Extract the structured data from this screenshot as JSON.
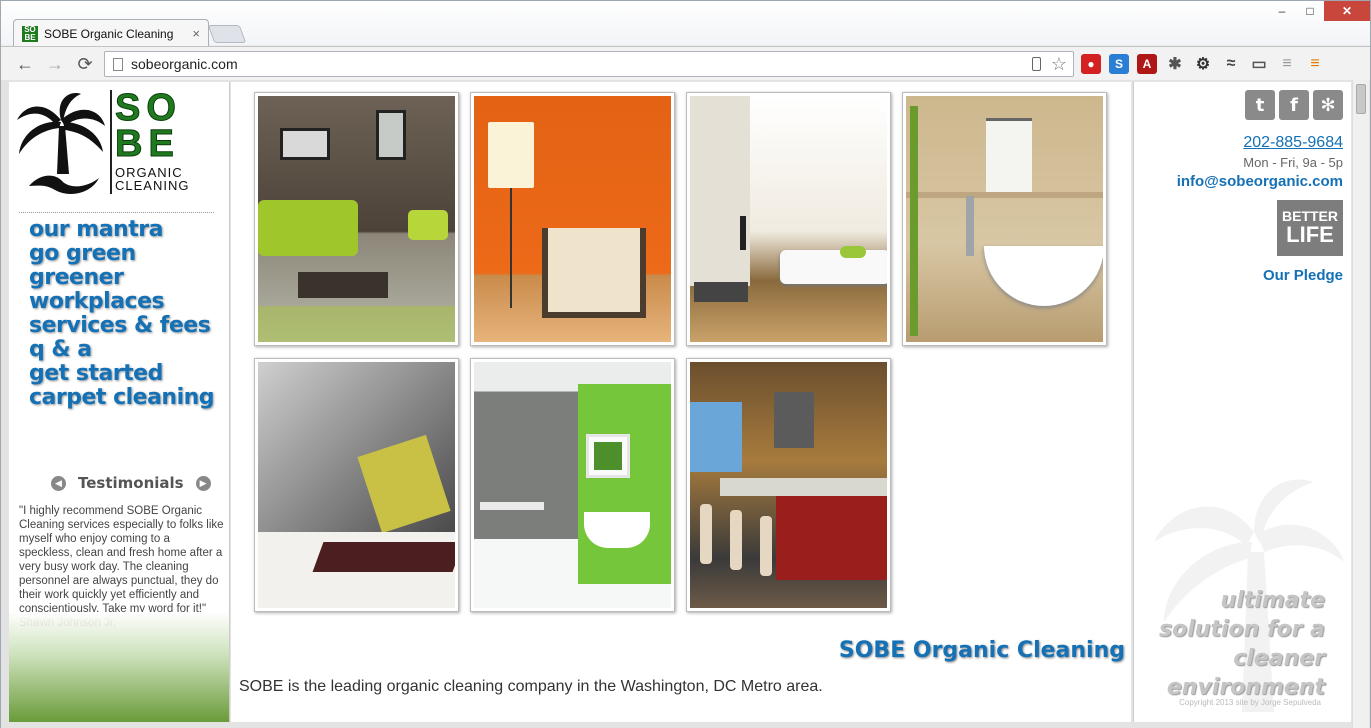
{
  "browser": {
    "tab_title": "SOBE Organic Cleaning",
    "tab_close": "×",
    "url": "sobeorganic.com",
    "back": "←",
    "forward": "→",
    "reload": "⟳",
    "star": "☆",
    "win_minimize": "–",
    "win_maximize": "□",
    "win_close": "✕",
    "extensions": [
      {
        "name": "stop-extension-icon",
        "glyph": "●",
        "color": "#d42121"
      },
      {
        "name": "skype-extension-icon",
        "glyph": "S",
        "color": "#2a7fd4"
      },
      {
        "name": "pdf-extension-icon",
        "glyph": "A",
        "color": "#b01717"
      },
      {
        "name": "bug-extension-icon",
        "glyph": "✱",
        "color": "#555555"
      },
      {
        "name": "settings-extension-icon",
        "glyph": "⚙",
        "color": "#333333"
      },
      {
        "name": "chart-extension-icon",
        "glyph": "≈",
        "color": "#444444"
      },
      {
        "name": "cast-icon",
        "glyph": "▭",
        "color": "#555555"
      },
      {
        "name": "notes-extension-icon",
        "glyph": "≡",
        "color": "#999999"
      },
      {
        "name": "chrome-menu-icon",
        "glyph": "≡",
        "color": "#e07b00"
      }
    ]
  },
  "logo": {
    "big": "SO\nBE",
    "sub": "ORGANIC\nCLEANING"
  },
  "menu": [
    "our mantra",
    "go green",
    "greener",
    "workplaces",
    "services & fees",
    "q & a",
    "get started",
    "carpet cleaning"
  ],
  "testimonials": {
    "prev": "◀",
    "next": "▶",
    "heading": "Testimonials",
    "text": "\"I highly recommend SOBE Organic Cleaning services especially to folks like myself who enjoy coming to a speckless, clean and fresh home after a very busy work day. The cleaning personnel are always punctual, they do their work quickly yet efficiently and conscientiously. Take my word for it!\" Shawn Johnson Jr."
  },
  "main": {
    "brand": "SOBE Organic Cleaning",
    "intro": "SOBE is the leading organic cleaning company in the Washington, DC Metro area."
  },
  "contact": {
    "social": [
      {
        "name": "twitter-icon",
        "glyph": "t"
      },
      {
        "name": "facebook-icon",
        "glyph": "f"
      },
      {
        "name": "yelp-icon",
        "glyph": "✻"
      }
    ],
    "phone": "202-885-9684",
    "hours": "Mon - Fri, 9a - 5p",
    "email": "info@sobeorganic.com",
    "better_top": "BETTER",
    "better_bottom": "LIFE",
    "pledge": "Our Pledge",
    "slogan": [
      "ultimate",
      "solution for a",
      "cleaner",
      "environment"
    ],
    "copyright": "Copyright 2013 site by Jorge Sepulveda"
  },
  "colors": {
    "accent_blue": "#1571b5",
    "logo_green": "#1f7a1f"
  }
}
